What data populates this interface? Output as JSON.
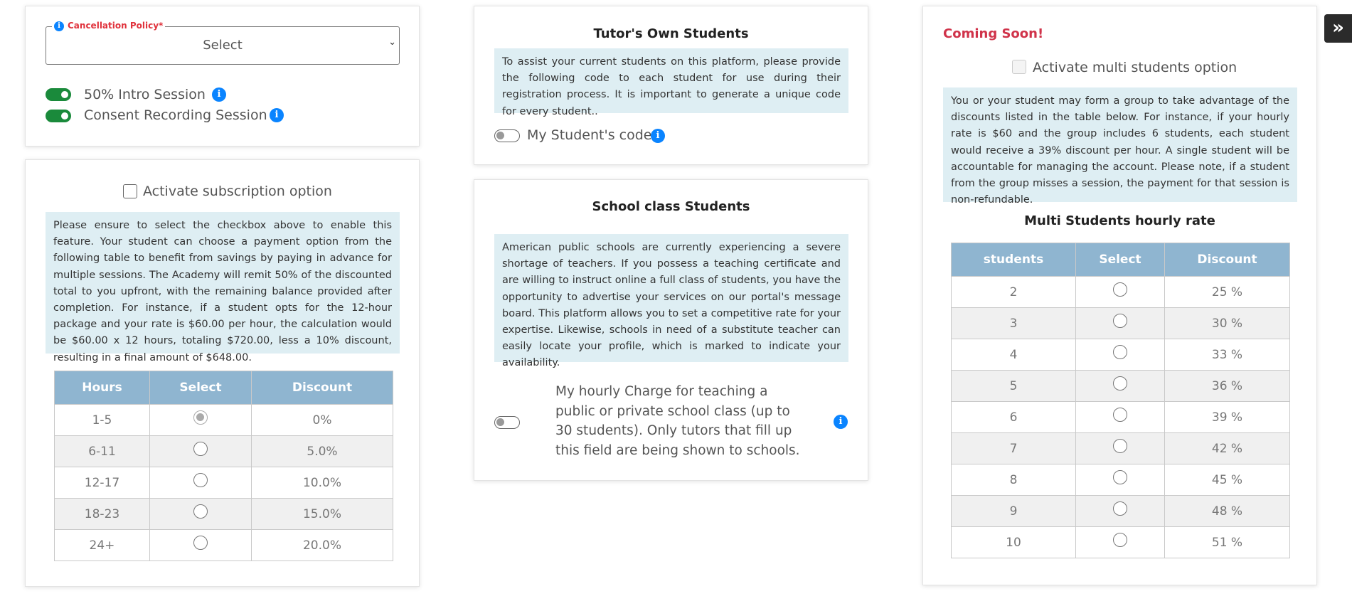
{
  "cancellation": {
    "legend": "Cancellation Policy*",
    "selected": "Select"
  },
  "intro_session": {
    "label": "50% Intro Session",
    "on": true
  },
  "consent_recording": {
    "label": "Consent Recording Session",
    "on": true
  },
  "subscription": {
    "checkbox_label": "Activate subscription option",
    "note": "Please ensure to select the checkbox above to enable this feature. Your student can choose a payment option from the following table to benefit from savings by paying in advance for multiple sessions. The Academy will remit 50% of the discounted total to you upfront, with the remaining balance provided after completion. For instance, if a student opts for the 12-hour package and your rate is $60.00 per hour, the calculation would be $60.00 x 12 hours, totaling $720.00, less a 10% discount, resulting in a final amount of $648.00.",
    "table": {
      "headers": [
        "Hours",
        "Select",
        "Discount"
      ],
      "rows": [
        {
          "hours": "1-5",
          "discount": "0%",
          "selected": true
        },
        {
          "hours": "6-11",
          "discount": "5.0%",
          "selected": false
        },
        {
          "hours": "12-17",
          "discount": "10.0%",
          "selected": false
        },
        {
          "hours": "18-23",
          "discount": "15.0%",
          "selected": false
        },
        {
          "hours": "24+",
          "discount": "20.0%",
          "selected": false
        }
      ]
    }
  },
  "own_students": {
    "title": "Tutor's Own Students",
    "note": "To assist your current students on this platform, please provide the following code to each student for use during their registration process. It is important to generate a unique code for every student..",
    "toggle_label": "My Student's code",
    "toggle_on": false
  },
  "school_class": {
    "title": "School class Students",
    "note": "American public schools are currently experiencing a severe shortage of teachers. If you possess a teaching certificate and are willing to instruct online a full class of students, you have the opportunity to advertise your services on our portal's message board. This platform allows you to set a competitive rate for your expertise. Likewise, schools in need of a substitute teacher can easily locate your profile, which is marked to indicate your availability.",
    "toggle_label": "My hourly Charge for teaching a public or private school class (up to 30 students). Only tutors that fill up this field are being shown to schools.",
    "toggle_on": false
  },
  "multi_students": {
    "coming_soon": "Coming Soon!",
    "checkbox_label": "Activate multi students option",
    "note": "You or your student may form a group to take advantage of the discounts listed in the table below. For instance, if your hourly rate is $60 and the group includes 6 students, each student would receive a 39% discount per hour. A single student will be accountable for managing the account. Please note, if a student from the group misses a session, the payment for that session is non-refundable.",
    "table_title": "Multi Students hourly rate",
    "table": {
      "headers": [
        "students",
        "Select",
        "Discount"
      ],
      "rows": [
        {
          "students": "2",
          "discount": "25 %"
        },
        {
          "students": "3",
          "discount": "30 %"
        },
        {
          "students": "4",
          "discount": "33 %"
        },
        {
          "students": "5",
          "discount": "36 %"
        },
        {
          "students": "6",
          "discount": "39 %"
        },
        {
          "students": "7",
          "discount": "42 %"
        },
        {
          "students": "8",
          "discount": "45 %"
        },
        {
          "students": "9",
          "discount": "48 %"
        },
        {
          "students": "10",
          "discount": "51 %"
        }
      ]
    }
  },
  "sidebar_toggle": {
    "glyph": "»"
  },
  "icons": [
    "info-icon",
    "double-chevron-right-icon",
    "chevron-down-icon"
  ],
  "colors": {
    "toggle_on": "#1a8a3b",
    "info": "#0a84ff",
    "table_header": "#8fb5d0",
    "note_bg": "#deeef3",
    "coming_soon": "#d0334a",
    "required": "#e0323c"
  }
}
